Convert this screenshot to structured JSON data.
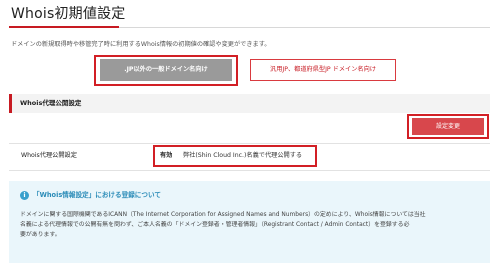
{
  "header": {
    "title": "Whois初期値設定",
    "description": "ドメインの新規取得時や移管完了時に利用するWhois情報の初期値の確認や変更ができます。"
  },
  "tabs": [
    {
      "label": ".JP以外の一般ドメイン名向け",
      "active": true
    },
    {
      "label": "汎用JP、都道府県型JP ドメイン名向け",
      "active": false
    }
  ],
  "section": {
    "title": "Whois代理公開設定",
    "change_button": "設定変更",
    "row": {
      "label": "Whois代理公開設定",
      "status": "有効",
      "value": "弊社(Shin Cloud Inc.)名義で代理公開する"
    }
  },
  "info": {
    "icon": "info-icon",
    "icon_glyph": "i",
    "title": "「Whois情報設定」における登録について",
    "lines": [
      "ドメインに関する国際機関であるICANN（The Internet Corporation for Assigned Names and Numbers）の定めにより、Whois情報については当社",
      "名義による代理情報での公開有無を問わず、ご本人名義の「ドメイン登録者・管理者情報」（Registrant Contact / Admin Contact）を登録する必",
      "要があります。"
    ]
  },
  "colors": {
    "accent_red": "#c71a22",
    "button_red": "#d8474c",
    "active_tab_grey": "#9a9a9a",
    "info_bg": "#eaf6fb",
    "info_blue": "#2b8cb8"
  }
}
